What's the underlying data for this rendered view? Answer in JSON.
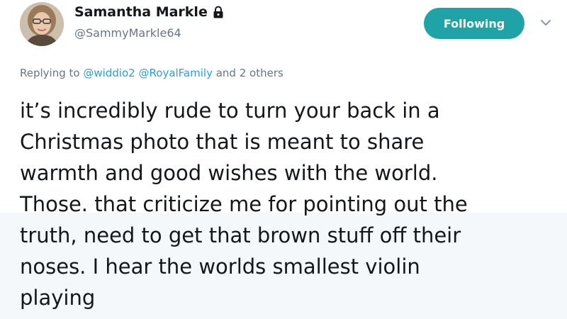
{
  "author": {
    "display_name": "Samantha Markle",
    "handle": "@SammyMarkle64",
    "avatar_icon": "user-avatar-photo",
    "protected_icon": "lock-icon"
  },
  "follow_button": {
    "label": "Following"
  },
  "menu": {
    "icon": "chevron-down-icon"
  },
  "reply_context": {
    "prefix": "Replying to",
    "mentions": [
      "@widdio2",
      "@RoyalFamily"
    ],
    "suffix": "and 2 others"
  },
  "tweet": {
    "lines": [
      "it’s incredibly rude to turn your back in a",
      "Christmas photo that is meant to share",
      "warmth and good wishes with the world.",
      "Those. that criticize me for pointing out the",
      "truth, need to get that brown stuff off their",
      "noses. I hear the worlds smallest violin",
      "playing"
    ]
  },
  "colors": {
    "accent": "#20a3a6",
    "link": "#2a9fd6",
    "muted": "#657786",
    "text": "#14171a"
  }
}
